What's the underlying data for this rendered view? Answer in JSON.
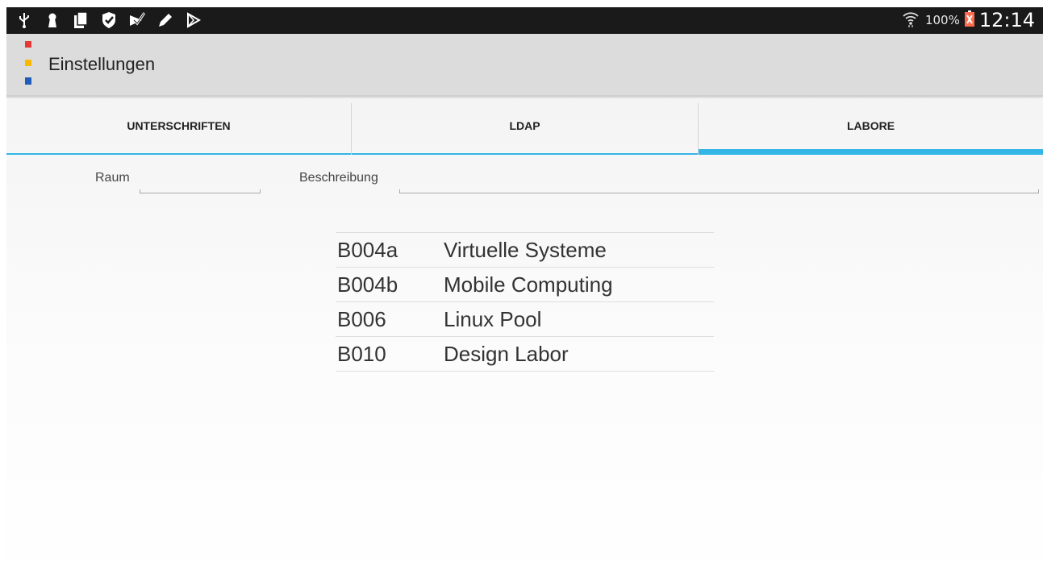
{
  "status_bar": {
    "left_icons": [
      "usb-icon",
      "keyhole-icon",
      "copy-icon",
      "shield-check-icon",
      "tasks-check-icon",
      "pencil-icon",
      "play-store-icon"
    ],
    "battery_percent": "100%",
    "time": "12:14"
  },
  "action_bar": {
    "title": "Einstellungen",
    "logo_colors": [
      "#e53935",
      "#fbb800",
      "#1e5db9"
    ]
  },
  "tabs": [
    {
      "label": "UNTERSCHRIFTEN",
      "selected": false
    },
    {
      "label": "LDAP",
      "selected": false
    },
    {
      "label": "LABORE",
      "selected": true
    }
  ],
  "form": {
    "room_label": "Raum",
    "room_value": "",
    "description_label": "Beschreibung",
    "description_value": ""
  },
  "labs": [
    {
      "room": "B004a",
      "description": "Virtuelle Systeme"
    },
    {
      "room": "B004b",
      "description": "Mobile Computing"
    },
    {
      "room": "B006",
      "description": "Linux Pool"
    },
    {
      "room": "B010",
      "description": "Design Labor"
    }
  ],
  "colors": {
    "accent": "#33b5e5",
    "status_bar": "#1a1a1a",
    "action_bar": "#dcdcdc"
  }
}
